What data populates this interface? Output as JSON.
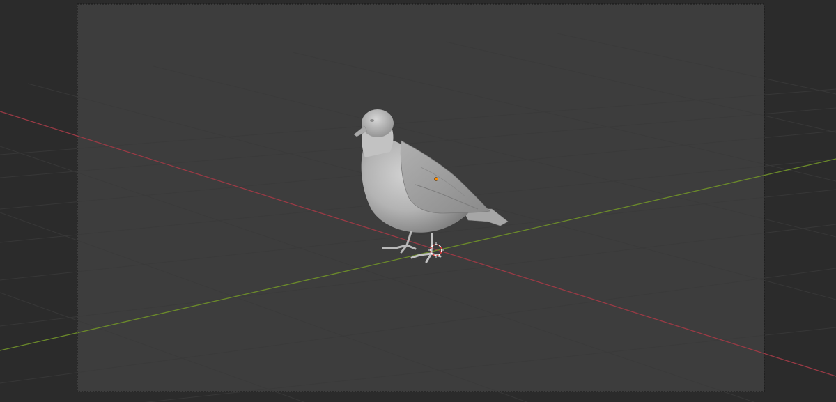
{
  "app": {
    "name": "3D Viewport"
  },
  "scene": {
    "background_color": "#2b2b2b",
    "camera_frame_fill": "#3d3d3d",
    "camera_frame_border": "#151515",
    "x_axis_color": "#9a3a45",
    "y_axis_color": "#6b8a2a",
    "grid_color": "#3a3a3a",
    "object": {
      "type": "mesh",
      "depicts": "pigeon",
      "shading": "solid",
      "color": "#b4b4b4",
      "selected": true,
      "origin_color": "#ff8c00"
    },
    "cursor_3d": {
      "icon": "3d-cursor-icon",
      "ring_colors": [
        "#e23c3c",
        "#ffffff"
      ]
    }
  }
}
